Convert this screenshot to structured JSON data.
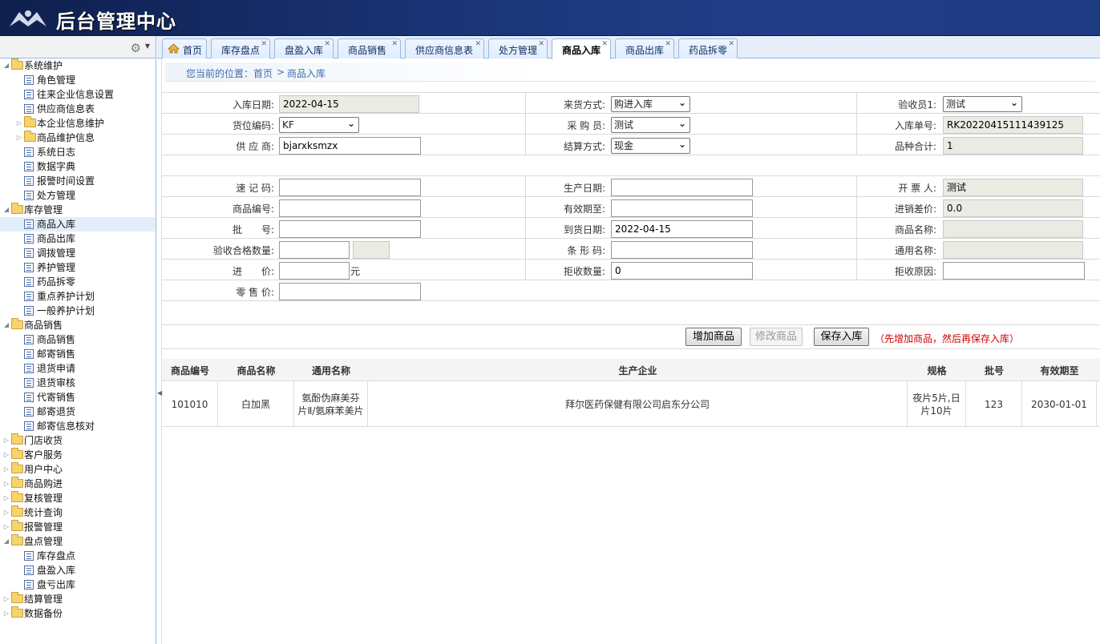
{
  "header": {
    "title": "后台管理中心"
  },
  "sidebar": {
    "tree": [
      {
        "label": "系统维护",
        "type": "folder",
        "state": "open",
        "level": 0
      },
      {
        "label": "角色管理",
        "type": "file",
        "level": 1
      },
      {
        "label": "往来企业信息设置",
        "type": "file",
        "level": 1
      },
      {
        "label": "供应商信息表",
        "type": "file",
        "level": 1
      },
      {
        "label": "本企业信息维护",
        "type": "folder",
        "state": "closed",
        "level": 1
      },
      {
        "label": "商品维护信息",
        "type": "folder",
        "state": "closed",
        "level": 1
      },
      {
        "label": "系统日志",
        "type": "file",
        "level": 1
      },
      {
        "label": "数据字典",
        "type": "file",
        "level": 1
      },
      {
        "label": "报警时间设置",
        "type": "file",
        "level": 1
      },
      {
        "label": "处方管理",
        "type": "file",
        "level": 1
      },
      {
        "label": "库存管理",
        "type": "folder",
        "state": "open",
        "level": 0
      },
      {
        "label": "商品入库",
        "type": "file",
        "level": 1,
        "selected": true
      },
      {
        "label": "商品出库",
        "type": "file",
        "level": 1
      },
      {
        "label": "调拨管理",
        "type": "file",
        "level": 1
      },
      {
        "label": "养护管理",
        "type": "file",
        "level": 1
      },
      {
        "label": "药品拆零",
        "type": "file",
        "level": 1
      },
      {
        "label": "重点养护计划",
        "type": "file",
        "level": 1
      },
      {
        "label": "一般养护计划",
        "type": "file",
        "level": 1
      },
      {
        "label": "商品销售",
        "type": "folder",
        "state": "open",
        "level": 0
      },
      {
        "label": "商品销售",
        "type": "file",
        "level": 1
      },
      {
        "label": "邮寄销售",
        "type": "file",
        "level": 1
      },
      {
        "label": "退货申请",
        "type": "file",
        "level": 1
      },
      {
        "label": "退货审核",
        "type": "file",
        "level": 1
      },
      {
        "label": "代寄销售",
        "type": "file",
        "level": 1
      },
      {
        "label": "邮寄退货",
        "type": "file",
        "level": 1
      },
      {
        "label": "邮寄信息核对",
        "type": "file",
        "level": 1
      },
      {
        "label": "门店收货",
        "type": "folder",
        "state": "closed",
        "level": 0
      },
      {
        "label": "客户服务",
        "type": "folder",
        "state": "closed",
        "level": 0
      },
      {
        "label": "用户中心",
        "type": "folder",
        "state": "closed",
        "level": 0
      },
      {
        "label": "商品购进",
        "type": "folder",
        "state": "closed",
        "level": 0
      },
      {
        "label": "复核管理",
        "type": "folder",
        "state": "closed",
        "level": 0
      },
      {
        "label": "统计查询",
        "type": "folder",
        "state": "closed",
        "level": 0
      },
      {
        "label": "报警管理",
        "type": "folder",
        "state": "closed",
        "level": 0
      },
      {
        "label": "盘点管理",
        "type": "folder",
        "state": "open",
        "level": 0
      },
      {
        "label": "库存盘点",
        "type": "file",
        "level": 1
      },
      {
        "label": "盘盈入库",
        "type": "file",
        "level": 1
      },
      {
        "label": "盘亏出库",
        "type": "file",
        "level": 1
      },
      {
        "label": "结算管理",
        "type": "folder",
        "state": "closed",
        "level": 0
      },
      {
        "label": "数据备份",
        "type": "folder",
        "state": "closed",
        "level": 0
      }
    ]
  },
  "tabs": [
    {
      "label": "首页",
      "closable": false
    },
    {
      "label": "库存盘点",
      "closable": true
    },
    {
      "label": "盘盈入库",
      "closable": true
    },
    {
      "label": "商品销售",
      "closable": true
    },
    {
      "label": "供应商信息表",
      "closable": true
    },
    {
      "label": "处方管理",
      "closable": true
    },
    {
      "label": "商品入库",
      "closable": true,
      "active": true
    },
    {
      "label": "商品出库",
      "closable": true
    },
    {
      "label": "药品拆零",
      "closable": true
    }
  ],
  "breadcrumb": {
    "prefix": "您当前的位置：",
    "home": "首页",
    "separator": ">",
    "current": "商品入库"
  },
  "form": {
    "in_date_label": "入库日期:",
    "in_date": "2022-04-15",
    "source_label": "来货方式:",
    "source": "购进入库",
    "inspector1_label": "验收员1:",
    "inspector1": "测试",
    "location_label": "货位编码:",
    "location": "KF",
    "buyer_label": "采 购 员:",
    "buyer": "测试",
    "order_no_label": "入库单号:",
    "order_no": "RK20220415111439125",
    "supplier_label": "供 应 商:",
    "supplier": "bjarxksmzx",
    "settle_label": "结算方式:",
    "settle": "现金",
    "variety_label": "品种合计:",
    "variety": "1",
    "quick_code_label": "速 记 码:",
    "quick_code": "",
    "prod_date_label": "生产日期:",
    "prod_date": "",
    "drawer_label": "开 票 人:",
    "drawer": "测试",
    "goods_no_label": "商品编号:",
    "goods_no": "",
    "expiry_label": "有效期至:",
    "expiry": "",
    "price_diff_label": "进销差价:",
    "price_diff": "0.0",
    "batch_label": "批　　号:",
    "batch": "",
    "arrive_label": "到货日期:",
    "arrive": "2022-04-15",
    "goods_name_label": "商品名称:",
    "goods_name": "",
    "qualified_label": "验收合格数量:",
    "qualified": "",
    "barcode_label": "条 形 码:",
    "barcode": "",
    "common_name_label": "通用名称:",
    "common_name": "",
    "in_price_label": "进　　价:",
    "in_price": "",
    "in_price_unit": "元",
    "reject_qty_label": "拒收数量:",
    "reject_qty": "0",
    "reject_reason_label": "拒收原因:",
    "reject_reason": "",
    "retail_label": "零 售 价:",
    "retail": ""
  },
  "actions": {
    "add": "增加商品",
    "edit": "修改商品",
    "save": "保存入库",
    "hint": "（先增加商品，然后再保存入库）"
  },
  "grid": {
    "columns": [
      "商品编号",
      "商品名称",
      "通用名称",
      "生产企业",
      "规格",
      "批号",
      "有效期至"
    ],
    "rows": [
      [
        "101010",
        "白加黑",
        "氨酚伪麻美芬片Ⅱ/氨麻苯美片",
        "拜尔医药保健有限公司启东分公司",
        "夜片5片,日片10片",
        "123",
        "2030-01-01"
      ]
    ]
  },
  "colors": {
    "header": "#1a3476",
    "border": "#95b8e7",
    "hint": "#d40000"
  }
}
